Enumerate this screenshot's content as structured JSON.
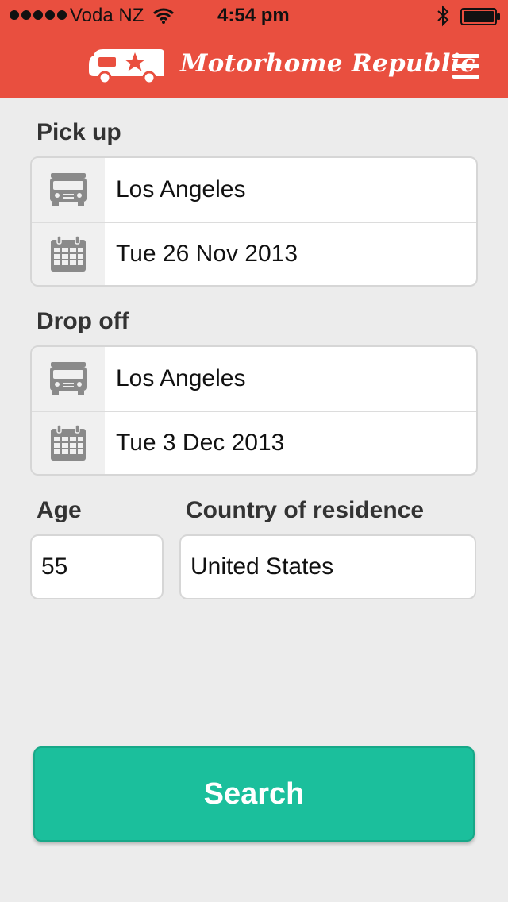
{
  "status_bar": {
    "carrier": "Voda NZ",
    "time": "4:54 pm"
  },
  "header": {
    "brand": "Motorhome Republic",
    "colors": {
      "bar": "#e94f3f",
      "text": "#ffffff"
    }
  },
  "pickup": {
    "label": "Pick up",
    "location": "Los Angeles",
    "date": "Tue 26 Nov 2013"
  },
  "dropoff": {
    "label": "Drop off",
    "location": "Los Angeles",
    "date": "Tue 3 Dec 2013"
  },
  "age": {
    "label": "Age",
    "value": "55"
  },
  "residence": {
    "label": "Country of residence",
    "value": "United States"
  },
  "search": {
    "label": "Search",
    "color": "#1bbf9c"
  },
  "icons": [
    "signal-icon",
    "wifi-icon",
    "bluetooth-icon",
    "battery-icon",
    "motorhome-logo-icon",
    "menu-icon",
    "van-icon",
    "calendar-icon"
  ]
}
